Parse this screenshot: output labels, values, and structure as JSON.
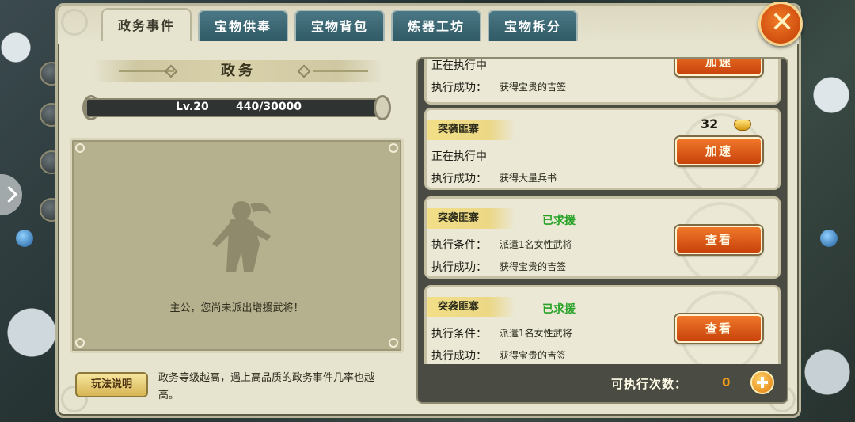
{
  "tabs": [
    {
      "label": "政务事件",
      "active": true
    },
    {
      "label": "宝物供奉",
      "active": false
    },
    {
      "label": "宝物背包",
      "active": false
    },
    {
      "label": "炼器工坊",
      "active": false
    },
    {
      "label": "宝物拆分",
      "active": false
    }
  ],
  "close_icon": "close-x",
  "left": {
    "section_title": "政务",
    "level": "Lv.20",
    "progress": "440/30000",
    "progress_fraction": 0.0147,
    "empty_hint": "主公，您尚未派出增援武将！",
    "help_button": "玩法说明",
    "help_text": "政务等级越高，遇上高品质的政务事件几率也越高。"
  },
  "events": [
    {
      "status": "正在执行中",
      "result_label": "执行成功：",
      "result_value": "获得宝贵的吉签",
      "button": "加速"
    },
    {
      "tag": "突袭匪寨",
      "status": "正在执行中",
      "result_label": "执行成功：",
      "result_value": "获得大量兵书",
      "button": "加速",
      "cost": "32",
      "cost_icon": "gold-ingot-icon"
    },
    {
      "tag": "突袭匪寨",
      "help_status": "已求援",
      "cond_label": "执行条件：",
      "cond_value": "派遣1名女性武将",
      "result_label": "执行成功：",
      "result_value": "获得宝贵的吉签",
      "button": "查看"
    },
    {
      "tag": "突袭匪寨",
      "help_status": "已求援",
      "cond_label": "执行条件：",
      "cond_value": "派遣1名女性武将",
      "result_label": "执行成功：",
      "result_value": "获得宝贵的吉签",
      "button": "查看"
    }
  ],
  "footer": {
    "exec_label": "可执行次数：",
    "exec_value": "0"
  },
  "colors": {
    "accent_orange": "#d8530f",
    "tab_teal": "#3b6975",
    "success_green": "#26a226",
    "panel_bg": "#e6e3cf"
  }
}
